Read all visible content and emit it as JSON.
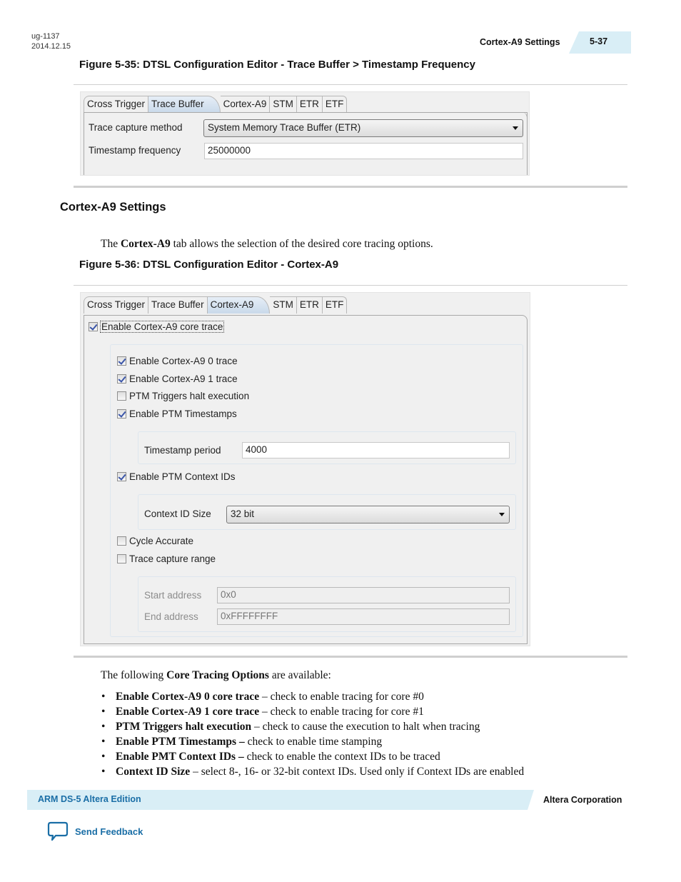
{
  "header": {
    "doc_id": "ug-1137",
    "doc_date": "2014.12.15",
    "section": "Cortex-A9 Settings",
    "page_number": "5-37"
  },
  "figure_35": {
    "title": "Figure 5-35: DTSL Configuration Editor - Trace Buffer > Timestamp Frequency",
    "tabs": [
      "Cross Trigger",
      "Trace Buffer",
      "Cortex-A9",
      "STM",
      "ETR",
      "ETF"
    ],
    "active_tab": "Trace Buffer",
    "trace_capture_method_label": "Trace capture method",
    "trace_capture_method_value": "System Memory Trace Buffer (ETR)",
    "timestamp_frequency_label": "Timestamp frequency",
    "timestamp_frequency_value": "25000000"
  },
  "section": {
    "heading": "Cortex-A9 Settings",
    "intro_pre": "The ",
    "intro_bold": "Cortex-A9",
    "intro_post": " tab allows the selection of the desired core tracing options."
  },
  "figure_36": {
    "title": "Figure 5-36: DTSL Configuration Editor - Cortex-A9",
    "tabs": [
      "Cross Trigger",
      "Trace Buffer",
      "Cortex-A9",
      "STM",
      "ETR",
      "ETF"
    ],
    "active_tab": "Cortex-A9",
    "enable_core_trace": {
      "label": "Enable Cortex-A9 core trace",
      "checked": true
    },
    "checkboxes": [
      {
        "label": "Enable Cortex-A9 0 trace",
        "checked": true
      },
      {
        "label": "Enable Cortex-A9 1 trace",
        "checked": true
      },
      {
        "label": "PTM Triggers halt execution",
        "checked": false
      },
      {
        "label": "Enable PTM Timestamps",
        "checked": true
      }
    ],
    "timestamp_period_label": "Timestamp period",
    "timestamp_period_value": "4000",
    "enable_context_ids": {
      "label": "Enable PTM Context IDs",
      "checked": true
    },
    "context_id_size_label": "Context ID Size",
    "context_id_size_value": "32 bit",
    "cycle_accurate": {
      "label": "Cycle Accurate",
      "checked": false
    },
    "trace_capture_range": {
      "label": "Trace capture range",
      "checked": false
    },
    "start_address_label": "Start address",
    "start_address_value": "0x0",
    "end_address_label": "End address",
    "end_address_value": "0xFFFFFFFF"
  },
  "options": {
    "intro_pre": "The following ",
    "intro_bold": "Core Tracing Options",
    "intro_post": " are available:",
    "items": [
      {
        "term": "Enable Cortex-A9 0 core trace",
        "desc": " – check to enable tracing for core #0"
      },
      {
        "term": "Enable Cortex-A9 1 core trace",
        "desc": " – check to enable tracing for core #1"
      },
      {
        "term": "PTM Triggers halt execution",
        "desc": " – check to cause the execution to halt when tracing"
      },
      {
        "term": "Enable PTM Timestamps –",
        "desc": " check to enable time stamping"
      },
      {
        "term": "Enable PMT Context IDs –",
        "desc": " check to enable the context IDs to be traced"
      },
      {
        "term": "Context ID Size",
        "desc": " – select 8-, 16- or 32-bit context IDs. Used only if Context IDs are enabled"
      }
    ]
  },
  "footer": {
    "product": "ARM DS-5 Altera Edition",
    "company": "Altera Corporation",
    "feedback_label": "Send Feedback",
    "feedback_icon": "speech-bubble-icon"
  },
  "colors": {
    "accent_blue": "#1a6ea6",
    "band_bg": "#d9eef6",
    "check_mark": "#3a55a8"
  }
}
